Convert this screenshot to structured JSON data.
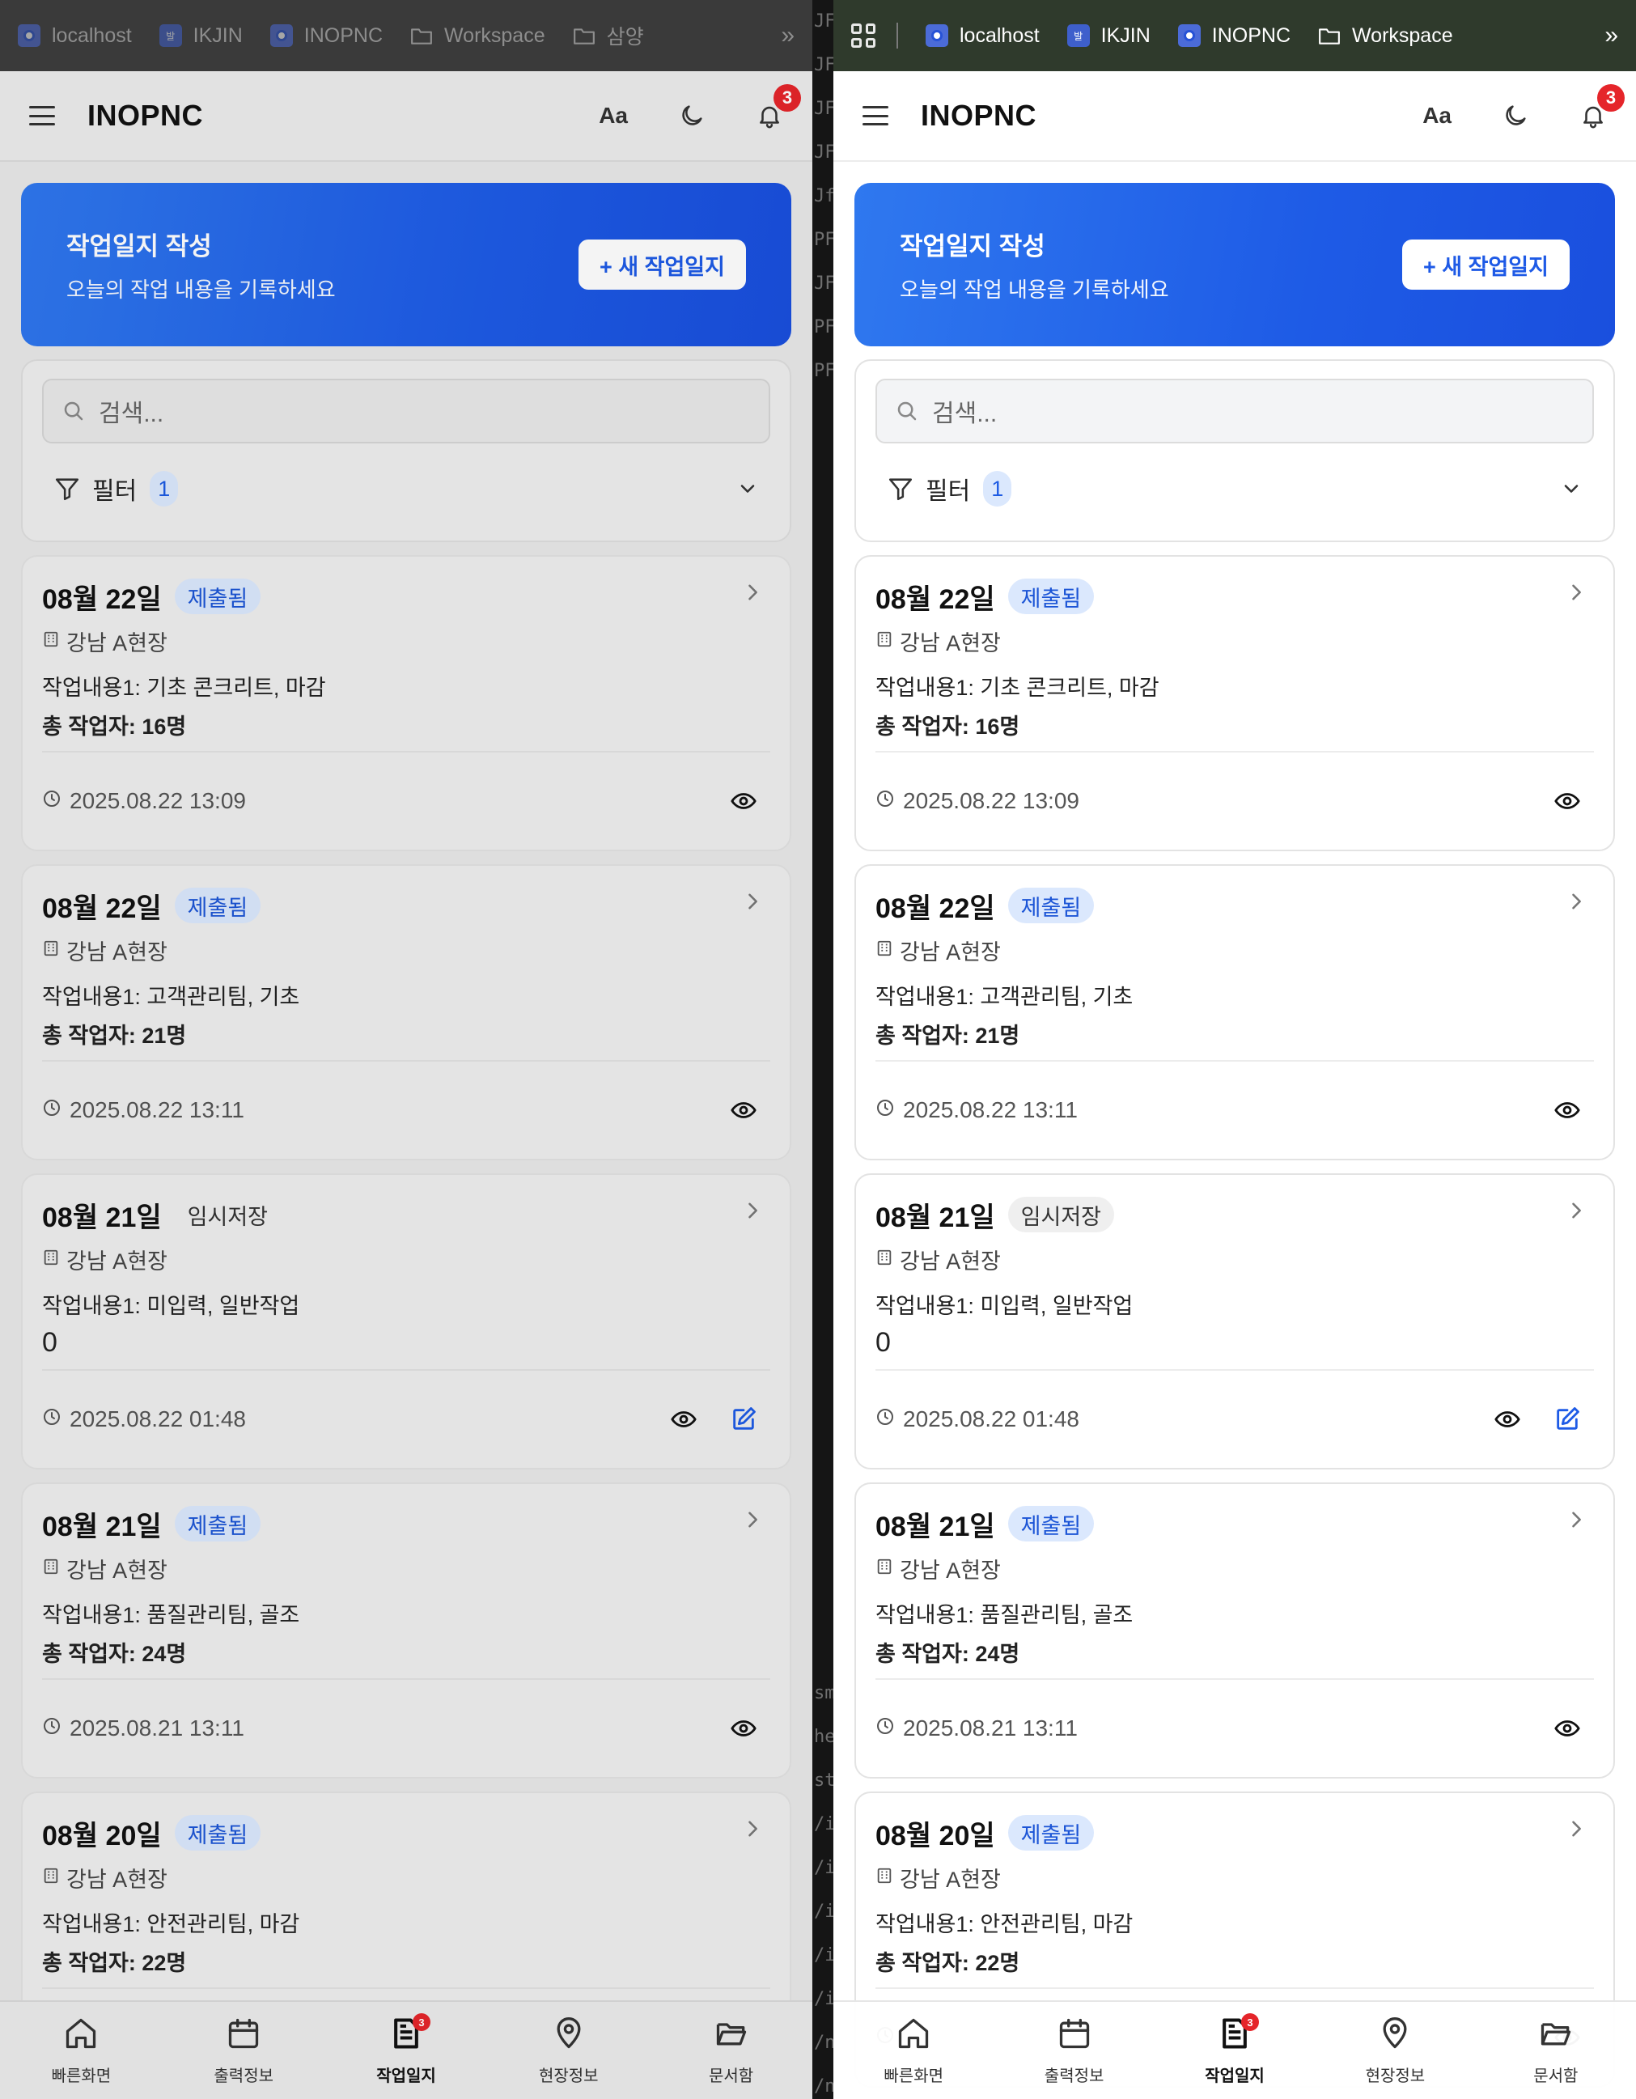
{
  "bookmarks_left": [
    "localhost",
    "IKJIN",
    "INOPNC",
    "Workspace",
    "삼양"
  ],
  "bookmarks_right": [
    "localhost",
    "IKJIN",
    "INOPNC",
    "Workspace"
  ],
  "bookmark_more": "»",
  "bookmark_badge_text": "발",
  "terminal_fragments": [
    "JF",
    "JF",
    "JF",
    "JF",
    "Jf",
    "PF",
    "JF",
    "PF",
    "PF",
    "sm",
    "he",
    "st",
    "/i",
    "/i",
    "/i",
    "/i",
    "/i",
    "/n",
    "/n",
    "/n",
    "-i"
  ],
  "app": {
    "brand": "INOPNC",
    "font_toggle": "Aa",
    "notification_count": "3"
  },
  "hero": {
    "title": "작업일지 작성",
    "subtitle": "오늘의 작업 내용을 기록하세요",
    "button_label": "+ 새 작업일지"
  },
  "search": {
    "placeholder": "검색..."
  },
  "filter": {
    "label": "필터",
    "count": "1"
  },
  "reports": [
    {
      "date": "08월 22일",
      "status": "제출됨",
      "site": "강남 A현장",
      "work": "작업내용1: 기초 콘크리트, 마감",
      "workers": "총 작업자: 16명",
      "timestamp": "2025.08.22 13:09"
    },
    {
      "date": "08월 22일",
      "status": "제출됨",
      "site": "강남 A현장",
      "work": "작업내용1: 고객관리팀, 기초",
      "workers": "총 작업자: 21명",
      "timestamp": "2025.08.22 13:11"
    },
    {
      "date": "08월 21일",
      "status": "임시저장",
      "site": "강남 A현장",
      "work": "작업내용1: 미입력, 일반작업",
      "workers": "0",
      "timestamp": "2025.08.22 01:48"
    },
    {
      "date": "08월 21일",
      "status": "제출됨",
      "site": "강남 A현장",
      "work": "작업내용1: 품질관리팀, 골조",
      "workers": "총 작업자: 24명",
      "timestamp": "2025.08.21 13:11"
    },
    {
      "date": "08월 20일",
      "status": "제출됨",
      "site": "강남 A현장",
      "work": "작업내용1: 안전관리팀, 마감",
      "workers": "총 작업자: 22명",
      "timestamp": ""
    }
  ],
  "bottom_nav": [
    "빠른화면",
    "출력정보",
    "작업일지",
    "현장정보",
    "문서함"
  ],
  "bottom_nav_badge": "3",
  "colors": {
    "accent": "#1e5be6",
    "badge": "#e5252a",
    "status_submitted_bg": "#dbe8fd"
  }
}
